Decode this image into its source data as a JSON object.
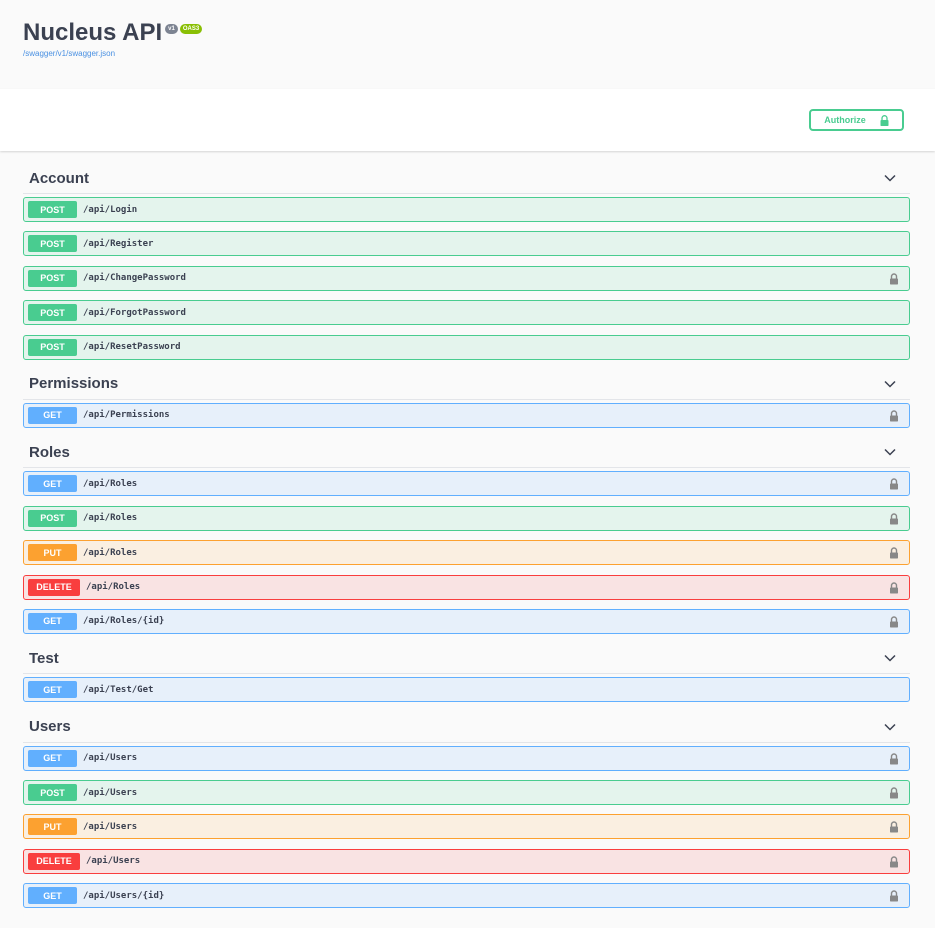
{
  "info": {
    "title": "Nucleus API",
    "version_badge": "v1",
    "oas_badge": "OAS3",
    "spec_link": "/swagger/v1/swagger.json"
  },
  "scheme": {
    "authorize_label": "Authorize"
  },
  "colors": {
    "post": "#49cc90",
    "get": "#61affe",
    "put": "#fca130",
    "delete": "#f93e3e"
  },
  "sections": [
    {
      "name": "Account",
      "ops": [
        {
          "method": "POST",
          "path": "/api/Login",
          "locked": false
        },
        {
          "method": "POST",
          "path": "/api/Register",
          "locked": false
        },
        {
          "method": "POST",
          "path": "/api/ChangePassword",
          "locked": true
        },
        {
          "method": "POST",
          "path": "/api/ForgotPassword",
          "locked": false
        },
        {
          "method": "POST",
          "path": "/api/ResetPassword",
          "locked": false
        }
      ]
    },
    {
      "name": "Permissions",
      "ops": [
        {
          "method": "GET",
          "path": "/api/Permissions",
          "locked": true
        }
      ]
    },
    {
      "name": "Roles",
      "ops": [
        {
          "method": "GET",
          "path": "/api/Roles",
          "locked": true
        },
        {
          "method": "POST",
          "path": "/api/Roles",
          "locked": true
        },
        {
          "method": "PUT",
          "path": "/api/Roles",
          "locked": true
        },
        {
          "method": "DELETE",
          "path": "/api/Roles",
          "locked": true
        },
        {
          "method": "GET",
          "path": "/api/Roles/{id}",
          "locked": true
        }
      ]
    },
    {
      "name": "Test",
      "ops": [
        {
          "method": "GET",
          "path": "/api/Test/Get",
          "locked": false
        }
      ]
    },
    {
      "name": "Users",
      "ops": [
        {
          "method": "GET",
          "path": "/api/Users",
          "locked": true
        },
        {
          "method": "POST",
          "path": "/api/Users",
          "locked": true
        },
        {
          "method": "PUT",
          "path": "/api/Users",
          "locked": true
        },
        {
          "method": "DELETE",
          "path": "/api/Users",
          "locked": true
        },
        {
          "method": "GET",
          "path": "/api/Users/{id}",
          "locked": true
        }
      ]
    }
  ]
}
